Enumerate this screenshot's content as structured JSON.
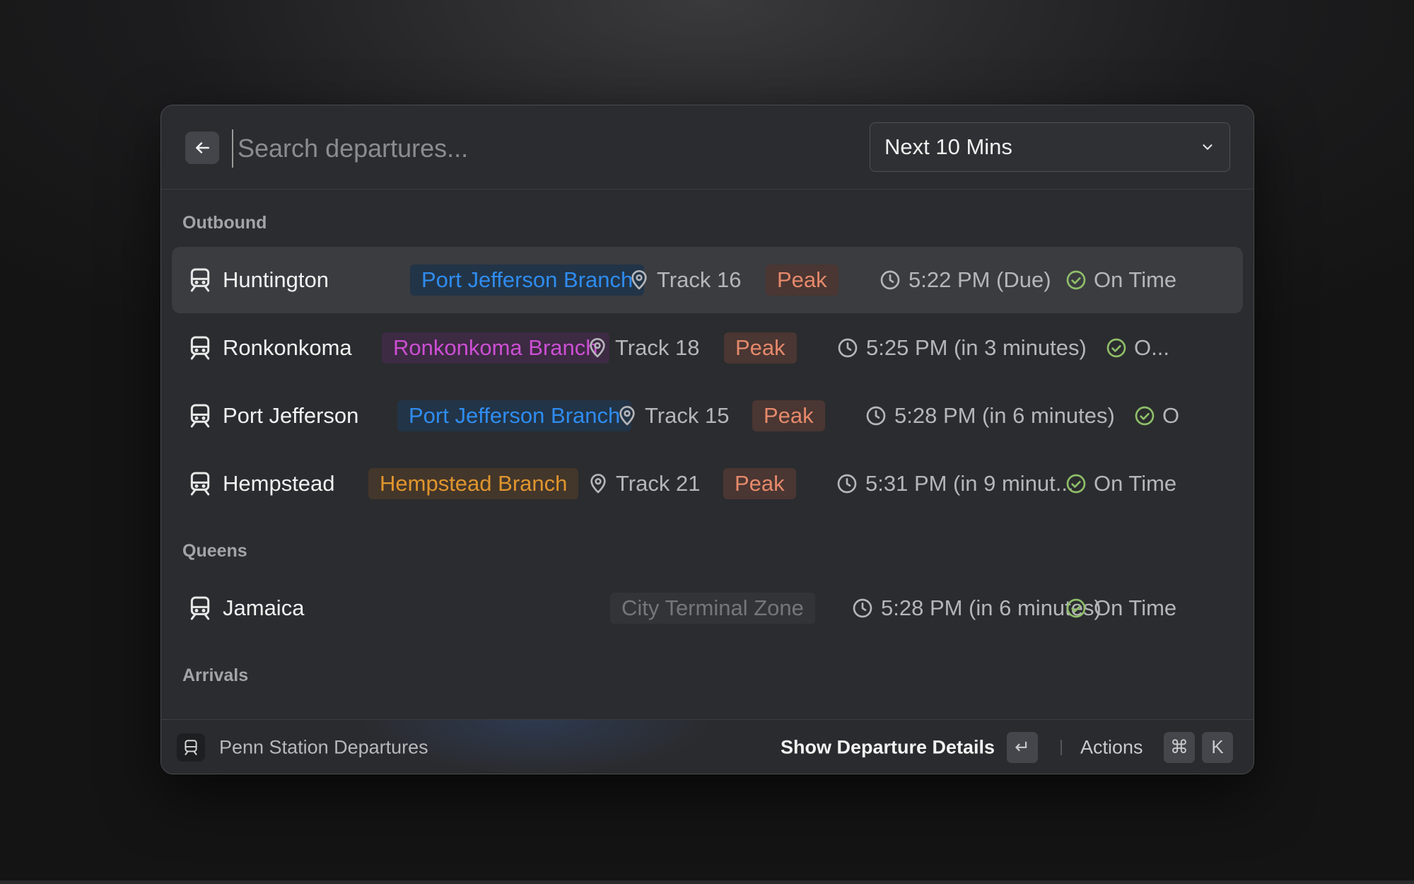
{
  "search": {
    "placeholder": "Search departures..."
  },
  "filter": {
    "selected": "Next 10 Mins"
  },
  "sections": {
    "outbound": "Outbound",
    "queens": "Queens",
    "arrivals": "Arrivals"
  },
  "outbound_rows": [
    {
      "station": "Huntington",
      "branch": "Port Jefferson Branch",
      "track": "Track 16",
      "peak": "Peak",
      "time": "5:22 PM (Due)",
      "status": "On Time"
    },
    {
      "station": "Ronkonkoma",
      "branch": "Ronkonkoma Branch",
      "track": "Track 18",
      "peak": "Peak",
      "time": "5:25 PM (in 3 minutes)",
      "status": "O..."
    },
    {
      "station": "Port Jefferson",
      "branch": "Port Jefferson Branch",
      "track": "Track 15",
      "peak": "Peak",
      "time": "5:28 PM (in 6 minutes)",
      "status": "O"
    },
    {
      "station": "Hempstead",
      "branch": "Hempstead Branch",
      "track": "Track 21",
      "peak": "Peak",
      "time": "5:31 PM (in 9 minut...",
      "status": "On Time"
    }
  ],
  "queens_rows": [
    {
      "station": "Jamaica",
      "zone": "City Terminal Zone",
      "time": "5:28 PM (in 6 minutes)",
      "status": "On Time"
    }
  ],
  "footer": {
    "title": "Penn Station Departures",
    "primary_action": "Show Departure Details",
    "enter_key": "↵",
    "actions_label": "Actions",
    "cmd_key": "⌘",
    "k_key": "K"
  },
  "colors": {
    "branch_port_jefferson_text": "#2f8cf0",
    "branch_port_jefferson_bg": "#223447",
    "branch_ronkonkoma_text": "#cc4fd3",
    "branch_ronkonkoma_bg": "#3d2a43",
    "branch_hempstead_text": "#e0952e",
    "branch_hempstead_bg": "#43362a",
    "peak_text": "#e5896b",
    "peak_bg": "#4a3632",
    "zone_text": "#75767a",
    "zone_bg": "#333437",
    "check": "#8fbf6a"
  },
  "icons": [
    "back-arrow-icon",
    "chevron-down-icon",
    "train-icon",
    "location-pin-icon",
    "clock-icon",
    "check-circle-icon"
  ]
}
